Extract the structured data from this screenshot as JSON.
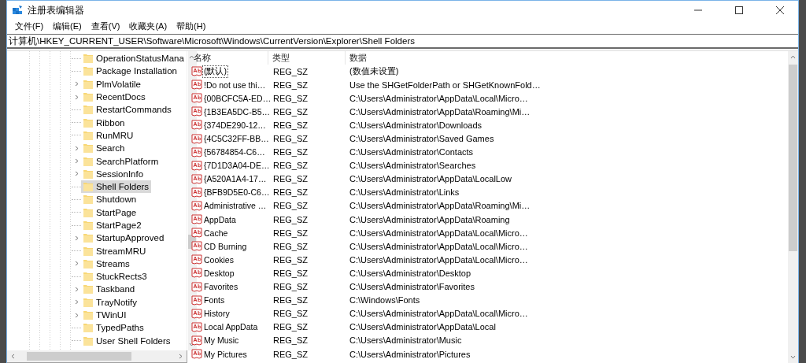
{
  "window": {
    "title": "注册表编辑器"
  },
  "menu": [
    {
      "label": "文件(F)"
    },
    {
      "label": "编辑(E)"
    },
    {
      "label": "查看(V)"
    },
    {
      "label": "收藏夹(A)"
    },
    {
      "label": "帮助(H)"
    }
  ],
  "address": {
    "value": "计算机\\HKEY_CURRENT_USER\\Software\\Microsoft\\Windows\\CurrentVersion\\Explorer\\Shell Folders"
  },
  "tree": {
    "items": [
      {
        "label": "OperationStatusMana",
        "expandable": false,
        "selected": false
      },
      {
        "label": "Package Installation",
        "expandable": false,
        "selected": false
      },
      {
        "label": "PlmVolatile",
        "expandable": true,
        "selected": false
      },
      {
        "label": "RecentDocs",
        "expandable": true,
        "selected": false
      },
      {
        "label": "RestartCommands",
        "expandable": false,
        "selected": false
      },
      {
        "label": "Ribbon",
        "expandable": false,
        "selected": false
      },
      {
        "label": "RunMRU",
        "expandable": false,
        "selected": false
      },
      {
        "label": "Search",
        "expandable": true,
        "selected": false
      },
      {
        "label": "SearchPlatform",
        "expandable": true,
        "selected": false
      },
      {
        "label": "SessionInfo",
        "expandable": true,
        "selected": false
      },
      {
        "label": "Shell Folders",
        "expandable": false,
        "selected": true
      },
      {
        "label": "Shutdown",
        "expandable": false,
        "selected": false
      },
      {
        "label": "StartPage",
        "expandable": false,
        "selected": false
      },
      {
        "label": "StartPage2",
        "expandable": false,
        "selected": false
      },
      {
        "label": "StartupApproved",
        "expandable": true,
        "selected": false
      },
      {
        "label": "StreamMRU",
        "expandable": false,
        "selected": false
      },
      {
        "label": "Streams",
        "expandable": true,
        "selected": false
      },
      {
        "label": "StuckRects3",
        "expandable": false,
        "selected": false
      },
      {
        "label": "Taskband",
        "expandable": true,
        "selected": false
      },
      {
        "label": "TrayNotify",
        "expandable": true,
        "selected": false
      },
      {
        "label": "TWinUI",
        "expandable": true,
        "selected": false
      },
      {
        "label": "TypedPaths",
        "expandable": false,
        "selected": false
      },
      {
        "label": "User Shell Folders",
        "expandable": false,
        "selected": false
      }
    ]
  },
  "table": {
    "columns": [
      "名称",
      "类型",
      "数据"
    ],
    "rows": [
      {
        "name": "(默认)",
        "type": "REG_SZ",
        "data": "(数值未设置)",
        "focused": true
      },
      {
        "name": "!Do not use thi…",
        "type": "REG_SZ",
        "data": "Use the SHGetFolderPath or SHGetKnownFold…",
        "focused": false
      },
      {
        "name": "{00BCFC5A-ED…",
        "type": "REG_SZ",
        "data": "C:\\Users\\Administrator\\AppData\\Local\\Micro…",
        "focused": false
      },
      {
        "name": "{1B3EA5DC-B5…",
        "type": "REG_SZ",
        "data": "C:\\Users\\Administrator\\AppData\\Roaming\\Mi…",
        "focused": false
      },
      {
        "name": "{374DE290-12…",
        "type": "REG_SZ",
        "data": "C:\\Users\\Administrator\\Downloads",
        "focused": false
      },
      {
        "name": "{4C5C32FF-BB…",
        "type": "REG_SZ",
        "data": "C:\\Users\\Administrator\\Saved Games",
        "focused": false
      },
      {
        "name": "{56784854-C6…",
        "type": "REG_SZ",
        "data": "C:\\Users\\Administrator\\Contacts",
        "focused": false
      },
      {
        "name": "{7D1D3A04-DE…",
        "type": "REG_SZ",
        "data": "C:\\Users\\Administrator\\Searches",
        "focused": false
      },
      {
        "name": "{A520A1A4-17…",
        "type": "REG_SZ",
        "data": "C:\\Users\\Administrator\\AppData\\LocalLow",
        "focused": false
      },
      {
        "name": "{BFB9D5E0-C6…",
        "type": "REG_SZ",
        "data": "C:\\Users\\Administrator\\Links",
        "focused": false
      },
      {
        "name": "Administrative …",
        "type": "REG_SZ",
        "data": "C:\\Users\\Administrator\\AppData\\Roaming\\Mi…",
        "focused": false
      },
      {
        "name": "AppData",
        "type": "REG_SZ",
        "data": "C:\\Users\\Administrator\\AppData\\Roaming",
        "focused": false
      },
      {
        "name": "Cache",
        "type": "REG_SZ",
        "data": "C:\\Users\\Administrator\\AppData\\Local\\Micro…",
        "focused": false
      },
      {
        "name": "CD Burning",
        "type": "REG_SZ",
        "data": "C:\\Users\\Administrator\\AppData\\Local\\Micro…",
        "focused": false
      },
      {
        "name": "Cookies",
        "type": "REG_SZ",
        "data": "C:\\Users\\Administrator\\AppData\\Local\\Micro…",
        "focused": false
      },
      {
        "name": "Desktop",
        "type": "REG_SZ",
        "data": "C:\\Users\\Administrator\\Desktop",
        "focused": false
      },
      {
        "name": "Favorites",
        "type": "REG_SZ",
        "data": "C:\\Users\\Administrator\\Favorites",
        "focused": false
      },
      {
        "name": "Fonts",
        "type": "REG_SZ",
        "data": "C:\\Windows\\Fonts",
        "focused": false
      },
      {
        "name": "History",
        "type": "REG_SZ",
        "data": "C:\\Users\\Administrator\\AppData\\Local\\Micro…",
        "focused": false
      },
      {
        "name": "Local AppData",
        "type": "REG_SZ",
        "data": "C:\\Users\\Administrator\\AppData\\Local",
        "focused": false
      },
      {
        "name": "My Music",
        "type": "REG_SZ",
        "data": "C:\\Users\\Administrator\\Music",
        "focused": false
      },
      {
        "name": "My Pictures",
        "type": "REG_SZ",
        "data": "C:\\Users\\Administrator\\Pictures",
        "focused": false
      }
    ]
  }
}
